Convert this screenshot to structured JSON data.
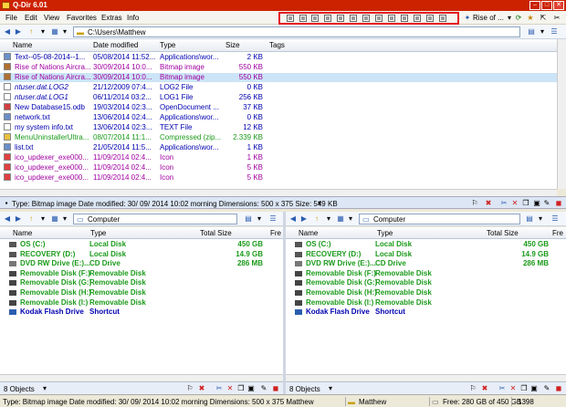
{
  "window": {
    "title": "Q-Dir 6.01",
    "min": "–",
    "max": "□",
    "close": "✕"
  },
  "menu": [
    "File",
    "Edit",
    "View",
    "Favorites",
    "Extras",
    "Info"
  ],
  "top_right": {
    "favorite_label": "Rise of ..."
  },
  "pane1": {
    "address": "C:\\Users\\Matthew",
    "columns": [
      "Name",
      "Date modified",
      "Type",
      "Size",
      "Tags"
    ],
    "rows": [
      {
        "name": "Text--05-08-2014--1...",
        "date": "05/08/2014 11:52...",
        "type": "Applications\\wor...",
        "size": "2 KB",
        "color": "#0000b0",
        "icon": "#6a8fc9"
      },
      {
        "name": "Rise of Nations Aircra...",
        "date": "30/09/2014 10:0...",
        "type": "Bitmap image",
        "size": "550 KB",
        "color": "#a000a0",
        "icon": "#b07030"
      },
      {
        "name": "Rise of Nations Aircra...",
        "date": "30/09/2014 10:0...",
        "type": "Bitmap image",
        "size": "550 KB",
        "color": "#a000a0",
        "icon": "#b07030"
      },
      {
        "name": "ntuser.dat.LOG2",
        "date": "21/12/2009 07:4...",
        "type": "LOG2 File",
        "size": "0 KB",
        "color": "#0000b0",
        "icon": "#ffffff",
        "italic": true
      },
      {
        "name": "ntuser.dat.LOG1",
        "date": "06/11/2014 03:2...",
        "type": "LOG1 File",
        "size": "256 KB",
        "color": "#0000b0",
        "icon": "#ffffff",
        "italic": true
      },
      {
        "name": "New Database15.odb",
        "date": "19/03/2014 02:3...",
        "type": "OpenDocument ...",
        "size": "37 KB",
        "color": "#0000b0",
        "icon": "#d04040"
      },
      {
        "name": "network.txt",
        "date": "13/06/2014 02:4...",
        "type": "Applications\\wor...",
        "size": "0 KB",
        "color": "#0000b0",
        "icon": "#6a8fc9"
      },
      {
        "name": "my system info.txt",
        "date": "13/06/2014 02:3...",
        "type": "TEXT File",
        "size": "12 KB",
        "color": "#0000b0",
        "icon": "#ffffff"
      },
      {
        "name": "MenuUninstallerUltra...",
        "date": "08/07/2014 11:1...",
        "type": "Compressed (zip...",
        "size": "2.339 KB",
        "color": "#1a9a1a",
        "icon": "#e8c040"
      },
      {
        "name": "list.txt",
        "date": "21/05/2014 11:5...",
        "type": "Applications\\wor...",
        "size": "1 KB",
        "color": "#0000b0",
        "icon": "#6a8fc9"
      },
      {
        "name": "ico_updexer_exe000...",
        "date": "11/09/2014 02:4...",
        "type": "Icon",
        "size": "1 KB",
        "color": "#a000a0",
        "icon": "#e04040"
      },
      {
        "name": "ico_updexer_exe000...",
        "date": "11/09/2014 02:4...",
        "type": "Icon",
        "size": "5 KB",
        "color": "#a000a0",
        "icon": "#e04040"
      },
      {
        "name": "ico_updexer_exe000...",
        "date": "11/09/2014 02:4...",
        "type": "Icon",
        "size": "5 KB",
        "color": "#a000a0",
        "icon": "#e04040"
      }
    ],
    "status": "Type: Bitmap image Date modified: 30/ 09/ 2014  10:02 morning Dimensions: 500 x 375  Size: 549 KB"
  },
  "pane_computer": {
    "address": "Computer",
    "columns": [
      "Name",
      "Type",
      "Total Size",
      "Fre"
    ],
    "rows": [
      {
        "name": "OS (C:)",
        "type": "Local Disk",
        "size": "450 GB",
        "kind": "hdd"
      },
      {
        "name": "RECOVERY (D:)",
        "type": "Local Disk",
        "size": "14.9 GB",
        "kind": "hdd"
      },
      {
        "name": "DVD RW Drive (E:)...",
        "type": "CD Drive",
        "size": "286 MB",
        "kind": "dvd"
      },
      {
        "name": "Removable Disk (F:)",
        "type": "Removable Disk",
        "size": "",
        "kind": "usb"
      },
      {
        "name": "Removable Disk (G:)",
        "type": "Removable Disk",
        "size": "",
        "kind": "usb"
      },
      {
        "name": "Removable Disk (H:)",
        "type": "Removable Disk",
        "size": "",
        "kind": "usb"
      },
      {
        "name": "Removable Disk (I:)",
        "type": "Removable Disk",
        "size": "",
        "kind": "usb"
      },
      {
        "name": "Kodak Flash Drive",
        "type": "Shortcut",
        "size": "",
        "kind": "shortcut"
      }
    ],
    "objects": "8 Objects"
  },
  "bottom_status": {
    "left": "Type: Bitmap image Date modified: 30/ 09/ 2014  10:02 morning Dimensions: 500 x 375 Matthew",
    "folder": "Matthew",
    "free": "Free: 280 GB of 450 GB",
    "count": "1398"
  },
  "colors": {
    "title_bg": "#cc2200",
    "highlight": "#e41b23",
    "green_text": "#1a9a1a",
    "blue_text": "#0000b0",
    "purple_text": "#a000a0"
  }
}
